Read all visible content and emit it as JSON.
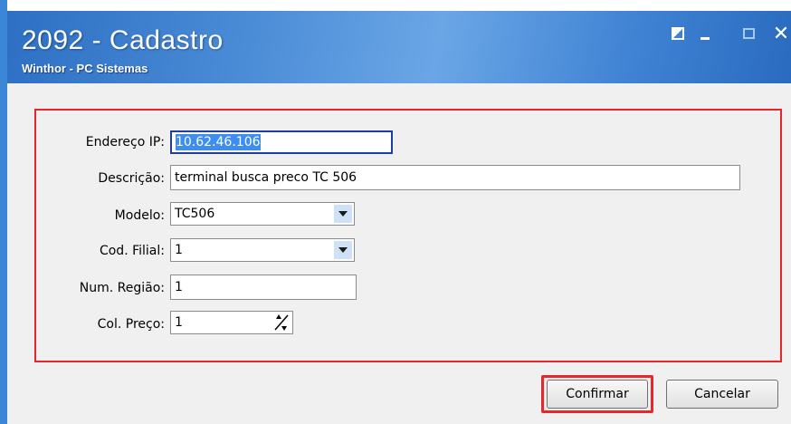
{
  "window": {
    "title": "2092 - Cadastro",
    "subtitle": "Winthor - PC Sistemas",
    "controls": {
      "restore": "restore-icon",
      "minimize": "minimize-icon",
      "maximize": "maximize-icon",
      "close": "✕"
    },
    "accent_color": "#3b86d6",
    "highlight_color": "#e8262c"
  },
  "form": {
    "ip": {
      "label": "Endereço IP:",
      "value": "10.62.46.106"
    },
    "descricao": {
      "label": "Descrição:",
      "value": "terminal busca preco TC 506"
    },
    "modelo": {
      "label": "Modelo:",
      "value": "TC506"
    },
    "filial": {
      "label": "Cod. Filial:",
      "value": "1"
    },
    "regiao": {
      "label": "Num. Região:",
      "value": "1"
    },
    "preco": {
      "label": "Col. Preço:",
      "value": "1"
    }
  },
  "buttons": {
    "confirm": "Confirmar",
    "cancel": "Cancelar"
  }
}
